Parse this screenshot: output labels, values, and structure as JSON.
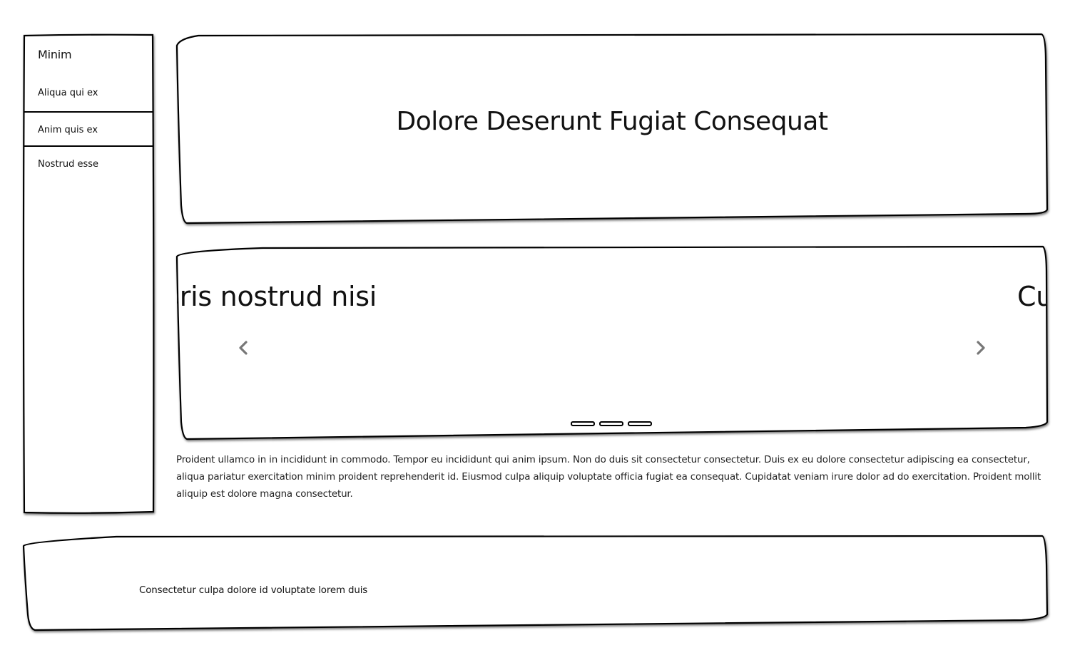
{
  "sidebar": {
    "brand": "Minim",
    "items": [
      {
        "label": "Aliqua qui ex"
      },
      {
        "label": "Anim quis ex"
      },
      {
        "label": "Nostrud esse"
      }
    ]
  },
  "header": {
    "title": "Dolore Deserunt Fugiat Consequat"
  },
  "carousel": {
    "slides": [
      {
        "text": "Laboris nostrud nisi"
      },
      {
        "text": "Cu"
      }
    ],
    "prev_icon": "chevron-left-icon",
    "next_icon": "chevron-right-icon",
    "indicator_count": 3
  },
  "body": {
    "paragraph": "Proident ullamco in in incididunt in commodo. Tempor eu incididunt qui anim ipsum. Non do duis sit consectetur consectetur. Duis ex eu dolore consectetur adipiscing ea consectetur, aliqua pariatur exercitation minim proident reprehenderit id. Eiusmod culpa aliquip voluptate officia fugiat ea consequat. Cupidatat veniam irure dolor ad do exercitation. Proident mollit aliquip est dolore magna consectetur."
  },
  "footer": {
    "text": "Consectetur culpa dolore id voluptate lorem duis"
  },
  "colors": {
    "stroke": "#000000",
    "background": "#ffffff",
    "arrow": "#777777"
  }
}
